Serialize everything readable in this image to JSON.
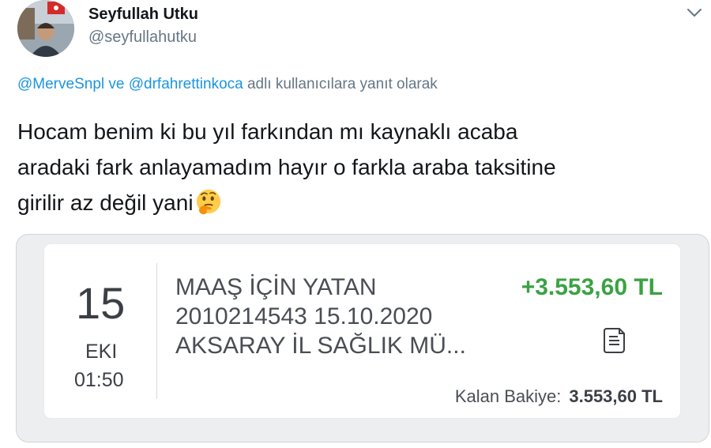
{
  "author": {
    "name": "Seyfullah Utku",
    "handle": "@seyfullahutku"
  },
  "reply": {
    "mention1": "@MerveSnpl",
    "connector": " ve ",
    "mention2": "@drfahrettinkoca",
    "suffix": " adlı kullanıcılara yanıt olarak"
  },
  "tweet": {
    "line1": "Hocam benim ki bu yıl farkından mı kaynaklı acaba",
    "line2": "aradaki fark anlayamadım hayır o farkla araba taksitine",
    "line3": "girilir az değil yani",
    "emoji": "thinking-face-icon"
  },
  "transaction": {
    "day": "15",
    "month": "EKI",
    "time": "01:50",
    "desc_line1": "MAAŞ İÇİN YATAN",
    "desc_line2": "2010214543 15.10.2020",
    "desc_line3": "AKSARAY İL SAĞLIK MÜ...",
    "amount": "+3.553,60 TL",
    "balance_label": "Kalan Bakiye:",
    "balance_value": "3.553,60 TL"
  },
  "colors": {
    "mention": "#1b95e0",
    "amount_positive": "#3aa244",
    "secondary_text": "#657786"
  }
}
